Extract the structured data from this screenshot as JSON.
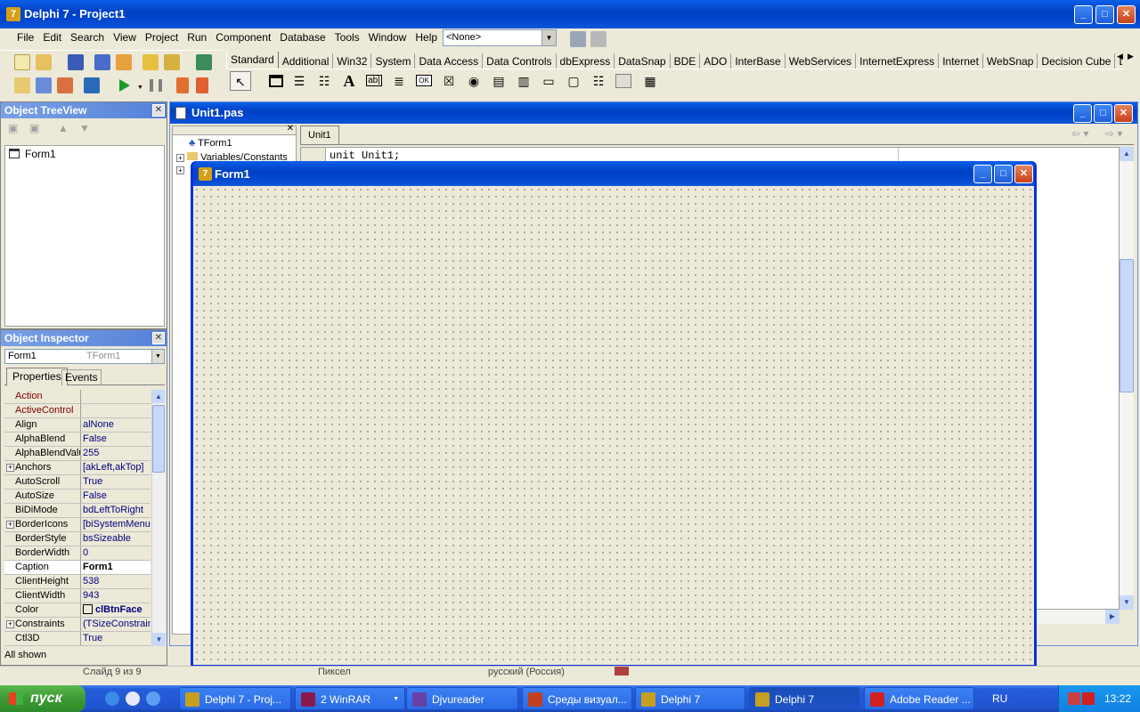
{
  "app": {
    "title": "Delphi 7 - Project1"
  },
  "menu": [
    "File",
    "Edit",
    "Search",
    "View",
    "Project",
    "Run",
    "Component",
    "Database",
    "Tools",
    "Window",
    "Help"
  ],
  "toolbar": {
    "config_combo": "<None>"
  },
  "palette": {
    "tabs": [
      "Standard",
      "Additional",
      "Win32",
      "System",
      "Data Access",
      "Data Controls",
      "dbExpress",
      "DataSnap",
      "BDE",
      "ADO",
      "InterBase",
      "WebServices",
      "InternetExpress",
      "Internet",
      "WebSnap",
      "Decision Cube",
      "Dialo"
    ]
  },
  "tree_view": {
    "title": "Object TreeView",
    "root": "Form1"
  },
  "inspector": {
    "title": "Object Inspector",
    "object": "Form1",
    "object_type": "TForm1",
    "tabs": [
      "Properties",
      "Events"
    ],
    "rows": [
      {
        "k": "Action",
        "v": "",
        "red": true
      },
      {
        "k": "ActiveControl",
        "v": "",
        "red": true
      },
      {
        "k": "Align",
        "v": "alNone"
      },
      {
        "k": "AlphaBlend",
        "v": "False"
      },
      {
        "k": "AlphaBlendValu",
        "v": "255"
      },
      {
        "k": "Anchors",
        "v": "[akLeft,akTop]",
        "plus": true
      },
      {
        "k": "AutoScroll",
        "v": "True"
      },
      {
        "k": "AutoSize",
        "v": "False"
      },
      {
        "k": "BiDiMode",
        "v": "bdLeftToRight"
      },
      {
        "k": "BorderIcons",
        "v": "[biSystemMenu,",
        "plus": true
      },
      {
        "k": "BorderStyle",
        "v": "bsSizeable"
      },
      {
        "k": "BorderWidth",
        "v": "0"
      },
      {
        "k": "Caption",
        "v": "Form1",
        "bold": true,
        "selected": true
      },
      {
        "k": "ClientHeight",
        "v": "538"
      },
      {
        "k": "ClientWidth",
        "v": "943"
      },
      {
        "k": "Color",
        "v": "clBtnFace",
        "bold": true,
        "swatch": "#ECE9D8"
      },
      {
        "k": "Constraints",
        "v": "(TSizeConstrain",
        "plus": true
      },
      {
        "k": "Ctl3D",
        "v": "True"
      }
    ],
    "status": "All shown"
  },
  "editor": {
    "title": "Unit1.pas",
    "tab": "Unit1",
    "code": "unit Unit1;",
    "explorer": [
      "TForm1",
      "Variables/Constants"
    ]
  },
  "form": {
    "title": "Form1"
  },
  "statusbar": {
    "slide": "Слайд 9 из 9",
    "units": "Пиксел",
    "lang": "русский (Россия)"
  },
  "taskbar": {
    "start": "пуск",
    "items": [
      {
        "label": "Delphi 7 - Proj...",
        "color": "#C8A020"
      },
      {
        "label": "2 WinRAR",
        "color": "#8B1A4A",
        "arrow": true
      },
      {
        "label": "Djvureader",
        "color": "#6A3FA8"
      },
      {
        "label": "Среды визуал...",
        "color": "#C04020"
      },
      {
        "label": "Delphi 7",
        "color": "#C8A020"
      },
      {
        "label": "Delphi 7",
        "color": "#C8A020",
        "active": true
      },
      {
        "label": "Adobe Reader ...",
        "color": "#D02020"
      }
    ],
    "lang": "RU",
    "clock": "13:22"
  },
  "colors": {
    "xp_blue": "#0A5FE8",
    "form_bg": "#ECE9D8",
    "taskbar": "#245DDA",
    "start_green": "#3C9A34"
  }
}
